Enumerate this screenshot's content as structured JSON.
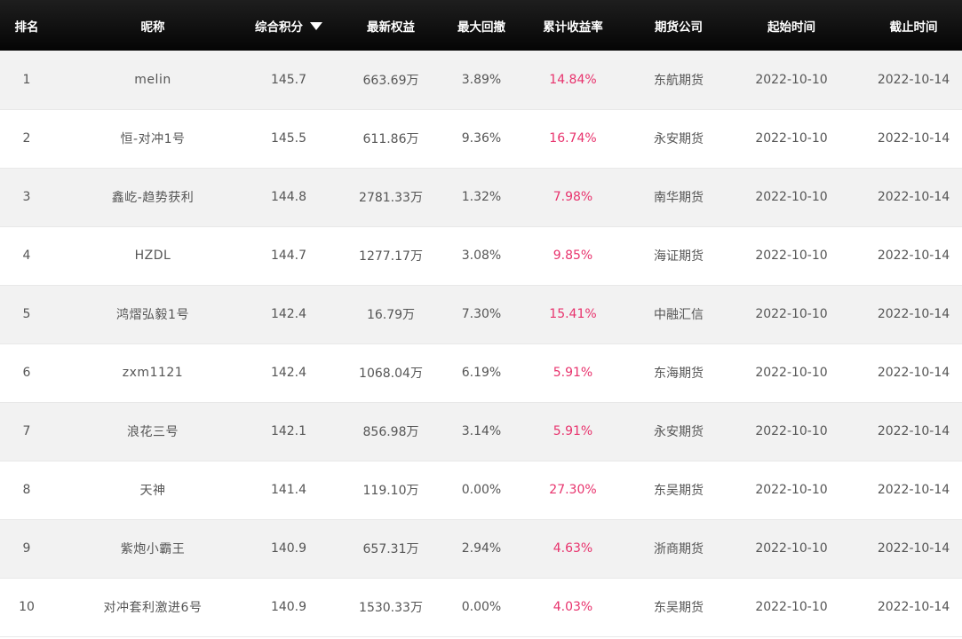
{
  "columns": [
    "排名",
    "昵称",
    "综合积分",
    "最新权益",
    "最大回撤",
    "累计收益率",
    "期货公司",
    "起始时间",
    "截止时间"
  ],
  "sort_icon": "sort-desc-icon",
  "accent": "#e8336d",
  "rows": [
    {
      "rank": "1",
      "name": "melin",
      "score": "145.7",
      "equity": "663.69万",
      "drawdown": "3.89%",
      "return": "14.84%",
      "company": "东航期货",
      "start": "2022-10-10",
      "end": "2022-10-14"
    },
    {
      "rank": "2",
      "name": "恒-对冲1号",
      "score": "145.5",
      "equity": "611.86万",
      "drawdown": "9.36%",
      "return": "16.74%",
      "company": "永安期货",
      "start": "2022-10-10",
      "end": "2022-10-14"
    },
    {
      "rank": "3",
      "name": "鑫屹-趋势获利",
      "score": "144.8",
      "equity": "2781.33万",
      "drawdown": "1.32%",
      "return": "7.98%",
      "company": "南华期货",
      "start": "2022-10-10",
      "end": "2022-10-14"
    },
    {
      "rank": "4",
      "name": "HZDL",
      "score": "144.7",
      "equity": "1277.17万",
      "drawdown": "3.08%",
      "return": "9.85%",
      "company": "海证期货",
      "start": "2022-10-10",
      "end": "2022-10-14"
    },
    {
      "rank": "5",
      "name": "鸿熠弘毅1号",
      "score": "142.4",
      "equity": "16.79万",
      "drawdown": "7.30%",
      "return": "15.41%",
      "company": "中融汇信",
      "start": "2022-10-10",
      "end": "2022-10-14"
    },
    {
      "rank": "6",
      "name": "zxm1121",
      "score": "142.4",
      "equity": "1068.04万",
      "drawdown": "6.19%",
      "return": "5.91%",
      "company": "东海期货",
      "start": "2022-10-10",
      "end": "2022-10-14"
    },
    {
      "rank": "7",
      "name": "浪花三号",
      "score": "142.1",
      "equity": "856.98万",
      "drawdown": "3.14%",
      "return": "5.91%",
      "company": "永安期货",
      "start": "2022-10-10",
      "end": "2022-10-14"
    },
    {
      "rank": "8",
      "name": "天神",
      "score": "141.4",
      "equity": "119.10万",
      "drawdown": "0.00%",
      "return": "27.30%",
      "company": "东吴期货",
      "start": "2022-10-10",
      "end": "2022-10-14"
    },
    {
      "rank": "9",
      "name": "紫炮小霸王",
      "score": "140.9",
      "equity": "657.31万",
      "drawdown": "2.94%",
      "return": "4.63%",
      "company": "浙商期货",
      "start": "2022-10-10",
      "end": "2022-10-14"
    },
    {
      "rank": "10",
      "name": "对冲套利激进6号",
      "score": "140.9",
      "equity": "1530.33万",
      "drawdown": "0.00%",
      "return": "4.03%",
      "company": "东吴期货",
      "start": "2022-10-10",
      "end": "2022-10-14"
    }
  ]
}
